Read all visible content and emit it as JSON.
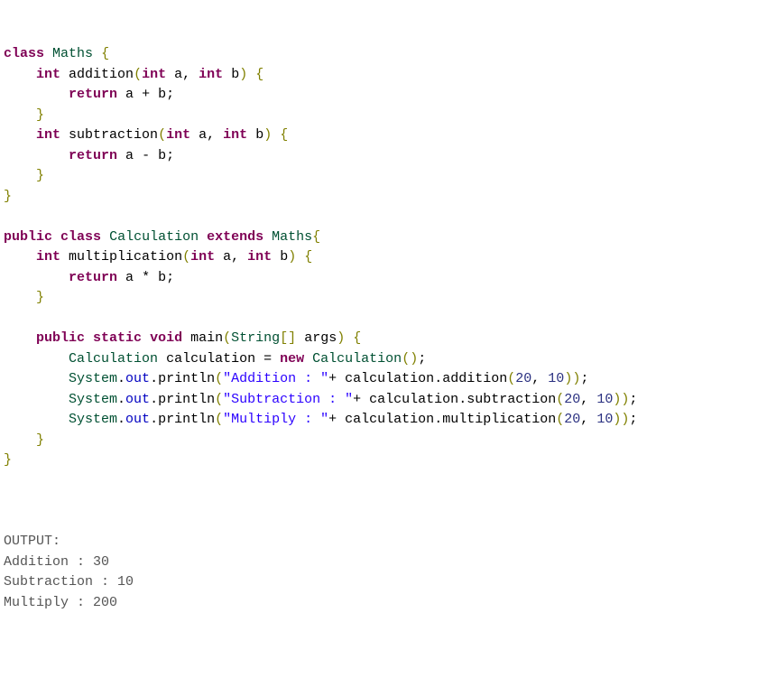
{
  "code": {
    "l1": {
      "kw1": "class",
      "cls": "Maths",
      "b": "{"
    },
    "l2": {
      "type": "int",
      "name": "addition",
      "p1": "(",
      "t1": "int",
      "a": "a",
      "c": ",",
      "t2": "int",
      "b2": "b",
      "p2": ")",
      "br": "{"
    },
    "l3": {
      "kw": "return",
      "a": "a",
      "op": "+",
      "b": "b",
      "sc": ";"
    },
    "l4": {
      "br": "}"
    },
    "l5": {
      "type": "int",
      "name": "subtraction",
      "p1": "(",
      "t1": "int",
      "a": "a",
      "c": ",",
      "t2": "int",
      "b2": "b",
      "p2": ")",
      "br": "{"
    },
    "l6": {
      "kw": "return",
      "a": "a",
      "op": "-",
      "b": "b",
      "sc": ";"
    },
    "l7": {
      "br": "}"
    },
    "l8": {
      "br": "}"
    },
    "l10": {
      "kw1": "public",
      "kw2": "class",
      "cls": "Calculation",
      "kw3": "extends",
      "sup": "Maths",
      "br": "{"
    },
    "l11": {
      "type": "int",
      "name": "multiplication",
      "p1": "(",
      "t1": "int",
      "a": "a",
      "c": ",",
      "t2": "int",
      "b2": "b",
      "p2": ")",
      "br": "{"
    },
    "l12": {
      "kw": "return",
      "a": "a",
      "op": "*",
      "b": "b",
      "sc": ";"
    },
    "l13": {
      "br": "}"
    },
    "l15": {
      "kw1": "public",
      "kw2": "static",
      "kw3": "void",
      "name": "main",
      "p1": "(",
      "cls": "String",
      "arr": "[]",
      "arg": "args",
      "p2": ")",
      "br": "{"
    },
    "l16": {
      "cls": "Calculation",
      "var": "calculation",
      "eq": "=",
      "kw": "new",
      "cls2": "Calculation",
      "p1": "(",
      "p2": ")",
      "sc": ";"
    },
    "l17": {
      "sys": "System",
      "dot1": ".",
      "out": "out",
      "dot2": ".",
      "pr": "println",
      "p1": "(",
      "str": "\"Addition : \"",
      "plus": "+",
      "var": "calculation",
      "dot3": ".",
      "m": "addition",
      "p2": "(",
      "n1": "20",
      "c": ",",
      "n2": "10",
      "p3": ")",
      "p4": ")",
      "sc": ";"
    },
    "l18": {
      "sys": "System",
      "dot1": ".",
      "out": "out",
      "dot2": ".",
      "pr": "println",
      "p1": "(",
      "str": "\"Subtraction : \"",
      "plus": "+",
      "var": "calculation",
      "dot3": ".",
      "m": "subtraction",
      "p2": "(",
      "n1": "20",
      "c": ",",
      "n2": "10",
      "p3": ")",
      "p4": ")",
      "sc": ";"
    },
    "l19": {
      "sys": "System",
      "dot1": ".",
      "out": "out",
      "dot2": ".",
      "pr": "println",
      "p1": "(",
      "str": "\"Multiply : \"",
      "plus": "+",
      "var": "calculation",
      "dot3": ".",
      "m": "multiplication",
      "p2": "(",
      "n1": "20",
      "c": ",",
      "n2": "10",
      "p3": ")",
      "p4": ")",
      "sc": ";"
    },
    "l20": {
      "br": "}"
    },
    "l21": {
      "br": "}"
    }
  },
  "output": {
    "label": "OUTPUT:",
    "o1": "Addition : 30",
    "o2": "Subtraction : 10",
    "o3": "Multiply : 200"
  }
}
